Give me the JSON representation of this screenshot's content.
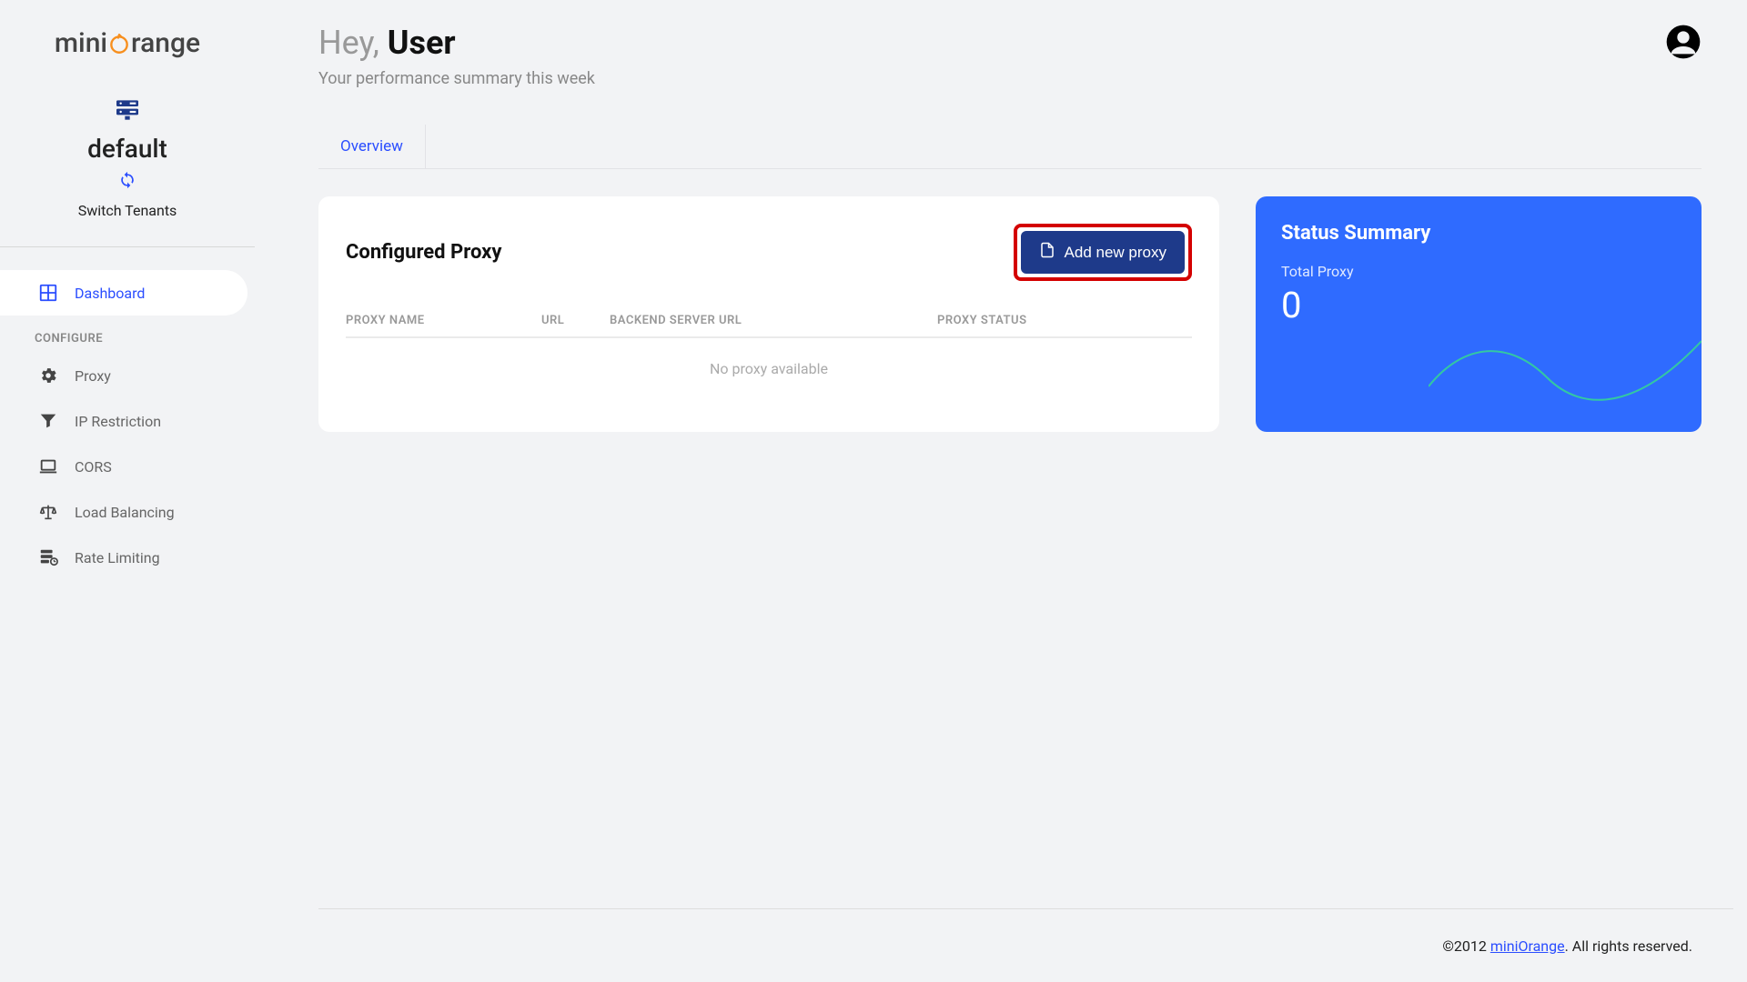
{
  "brand": {
    "part1": "mini",
    "part2": "range"
  },
  "tenant": {
    "name": "default",
    "switch_label": "Switch Tenants"
  },
  "nav": {
    "dashboard": "Dashboard",
    "section_label": "CONFIGURE",
    "proxy": "Proxy",
    "ip_restriction": "IP Restriction",
    "cors": "CORS",
    "load_balancing": "Load Balancing",
    "rate_limiting": "Rate Limiting"
  },
  "header": {
    "greeting": "Hey, ",
    "username": "User",
    "subtitle": "Your performance summary this week"
  },
  "tabs": {
    "overview": "Overview"
  },
  "proxy_card": {
    "title": "Configured Proxy",
    "add_button": "Add new proxy",
    "columns": {
      "name": "PROXY NAME",
      "url": "URL",
      "backend": "BACKEND SERVER URL",
      "status": "PROXY STATUS"
    },
    "empty": "No proxy available"
  },
  "status_card": {
    "title": "Status Summary",
    "label": "Total Proxy",
    "value": "0"
  },
  "footer": {
    "copyright": "©2012 ",
    "link": "miniOrange",
    "rights": ". All rights reserved."
  }
}
